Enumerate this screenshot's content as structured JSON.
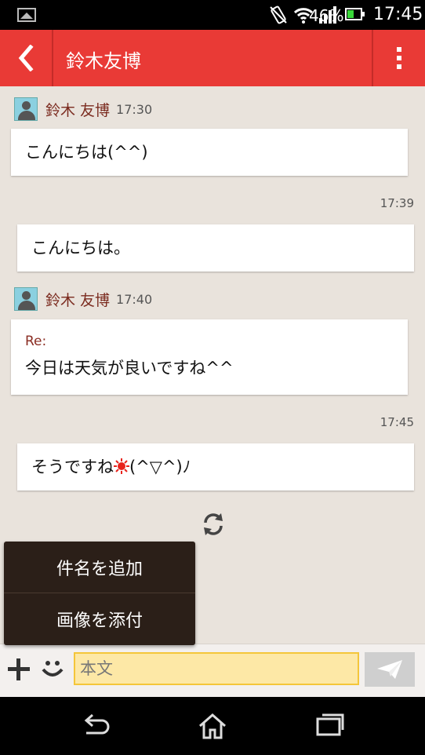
{
  "status_bar": {
    "battery_percent_text": "46%",
    "battery_level": 0.46,
    "time": "17:45"
  },
  "header": {
    "title": "鈴木友博"
  },
  "messages": [
    {
      "direction": "incoming",
      "sender": "鈴木 友博",
      "time": "17:30",
      "text": "こんにちは(^^)"
    },
    {
      "direction": "outgoing",
      "time": "17:39",
      "text": "こんにちは。"
    },
    {
      "direction": "incoming",
      "sender": "鈴木 友博",
      "time": "17:40",
      "subject": "Re:",
      "text": "今日は天気が良いですね^^"
    },
    {
      "direction": "outgoing",
      "time": "17:45",
      "text_before": "そうですね",
      "text_after": "(^▽^)ﾉ"
    }
  ],
  "popup_menu": {
    "items": [
      "件名を追加",
      "画像を添付"
    ]
  },
  "input_bar": {
    "placeholder": "本文",
    "value": ""
  },
  "colors": {
    "header": "#e93a36",
    "chat_background": "#e9e3dc",
    "input_field": "#fde8a6",
    "input_border": "#f4c63a",
    "sender_name": "#7b2b1f",
    "sun_emoji": "#e8231c"
  },
  "icons": [
    "gallery-icon",
    "vibrate-icon",
    "wifi-icon",
    "signal-icon",
    "battery-icon",
    "back-chevron-icon",
    "more-vert-icon",
    "avatar-icon",
    "refresh-icon",
    "plus-icon",
    "smiley-icon",
    "send-icon",
    "nav-back-icon",
    "nav-home-icon",
    "nav-recents-icon"
  ]
}
